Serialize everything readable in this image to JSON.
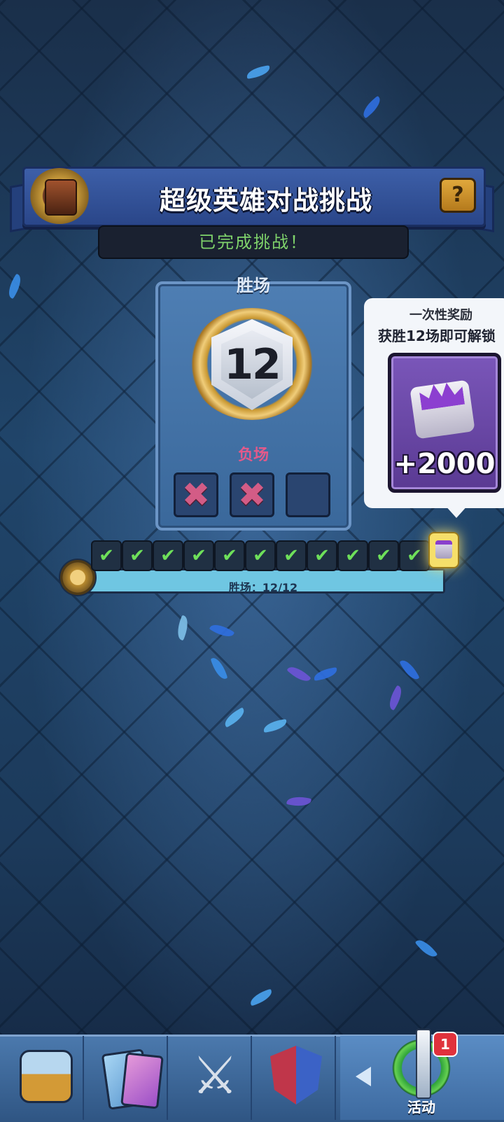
{
  "header": {
    "title": "超级英雄对战挑战",
    "help_icon": "?",
    "status": "已完成挑战！"
  },
  "wins_panel": {
    "wins_label": "胜场",
    "wins_count": "12",
    "losses_label": "负场",
    "losses": [
      "✖",
      "✖",
      ""
    ],
    "loss_mark_icon": "cross-icon"
  },
  "progress": {
    "text": "胜场：12/12",
    "completed": 12,
    "total": 12,
    "check_glyph": "✔"
  },
  "reward": {
    "title": "一次性奖励",
    "description": "获胜12场即可解锁",
    "amount": "+2000",
    "icon": "tower-skin-crown-icon"
  },
  "nav": {
    "tabs": [
      {
        "name": "shop",
        "icon": "chest-icon"
      },
      {
        "name": "cards",
        "icon": "cards-icon"
      },
      {
        "name": "battle",
        "icon": "crossed-swords-icon"
      },
      {
        "name": "clan",
        "icon": "clan-shield-icon"
      },
      {
        "name": "events",
        "icon": "sword-laurel-icon",
        "label": "活动",
        "badge": "1"
      }
    ],
    "active": "events"
  },
  "colors": {
    "accent_green": "#7fd36b",
    "loss_pink": "#e35a8a",
    "banner_blue": "#3d5fa8",
    "badge_red": "#e0323c"
  }
}
